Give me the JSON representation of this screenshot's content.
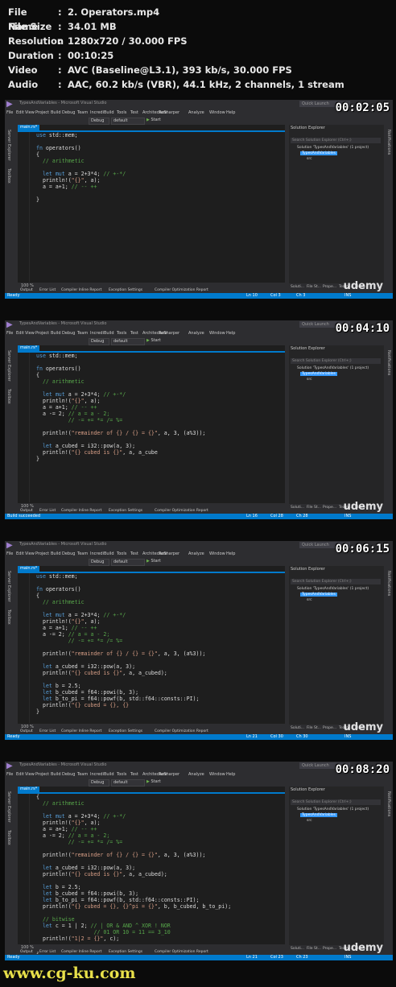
{
  "file_info": [
    {
      "key": "File Name",
      "value": "2. Operators.mp4"
    },
    {
      "key": "File Size",
      "value": "34.01 MB"
    },
    {
      "key": "Resolution",
      "value": "1280x720 / 30.000 FPS"
    },
    {
      "key": "Duration",
      "value": "00:10:25"
    },
    {
      "key": "Video",
      "value": "AVC (Baseline@L3.1), 393 kb/s, 30.000 FPS"
    },
    {
      "key": "Audio",
      "value": "AAC, 60.2 kb/s (VBR), 44.1 kHz, 2 channels, 1 stream"
    }
  ],
  "colon": ":",
  "common": {
    "window_title": "TypesAndVariables - Microsoft Visual Studio",
    "quick_launch": "Quick Launch",
    "menu": [
      "File",
      "Edit",
      "View",
      "Project",
      "Build",
      "Debug",
      "Team",
      "IncrediBuild",
      "Tools",
      "Test",
      "Architecture",
      "ReSharper",
      "Analyze",
      "Window",
      "Help"
    ],
    "debug_combo": "Debug",
    "platform_combo": "default",
    "start": "Start",
    "left_strip": [
      "Server Explorer",
      "Toolbox"
    ],
    "right_strip": "Notifications",
    "tab_name": "main.rs*",
    "zoom": "100 %",
    "solution_title": "Solution Explorer",
    "solution_search": "Search Solution Explorer (Ctrl+;)",
    "solution_root": "Solution 'TypesAndVariables' (1 project)",
    "project": "TypesAndVariables",
    "src": "src",
    "bottom_tabs": [
      "Output",
      "Error List",
      "Compiler Inline Report",
      "Exception Settings",
      "Compiler Optimization Report"
    ],
    "sol_tabs": [
      "Soluti...",
      "File St...",
      "Prope...",
      "Team...",
      "Class..."
    ],
    "watermark": "udemy",
    "ins": "INS"
  },
  "frames": [
    {
      "timestamp": "00:02:05",
      "status": {
        "left": "Ready",
        "ln": "Ln 10",
        "col": "Col 3",
        "ch": "Ch 3"
      }
    },
    {
      "timestamp": "00:04:10",
      "status": {
        "left": "Build succeeded",
        "ln": "Ln 16",
        "col": "Col 28",
        "ch": "Ch 28"
      }
    },
    {
      "timestamp": "00:06:15",
      "status": {
        "left": "Ready",
        "ln": "Ln 21",
        "col": "Col 30",
        "ch": "Ch 30"
      }
    },
    {
      "timestamp": "00:08:20",
      "status": {
        "left": "Ready",
        "ln": "Ln 21",
        "col": "Col 23",
        "ch": "Ch 23"
      }
    }
  ],
  "site_watermark": "www.cg-ku.com",
  "udemy_corner": "udemy"
}
